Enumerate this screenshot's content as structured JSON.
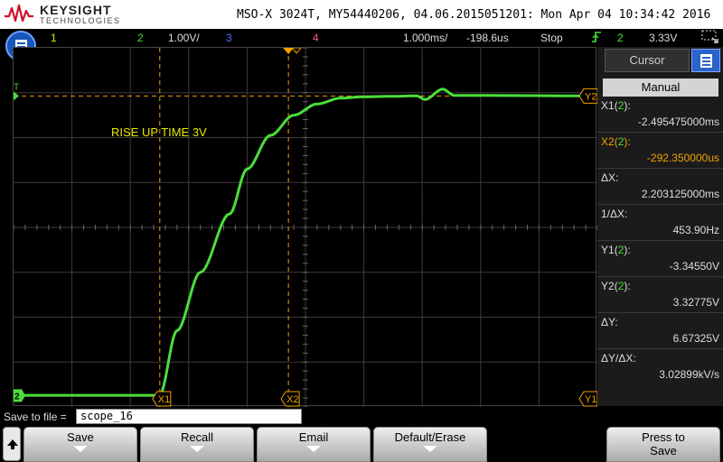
{
  "header": {
    "brand": "KEYSIGHT",
    "brand_sub": "TECHNOLOGIES",
    "scope_info": "MSO-X 3024T, MY54440206, 04.06.2015051201: Mon Apr 04 10:34:42 2016"
  },
  "statusbar": {
    "ch1": "1",
    "ch2": "2",
    "ch2_scale": "1.00V/",
    "ch3": "3",
    "ch4": "4",
    "timebase": "1.000ms/",
    "delay": "-198.6us",
    "run_state": "Stop",
    "trigger_channel": "2",
    "trigger_level": "3.33V"
  },
  "colors": {
    "ch1": "#e8e800",
    "ch2": "#4ade3a",
    "ch3": "#4a6fff",
    "ch4": "#ff4fa0",
    "cursor": "#f4a000",
    "grid": "#3c3c3c"
  },
  "waveform": {
    "annotation": "RISE UP TIME  3V",
    "channel_marker": "2",
    "cursor_labels": {
      "x1": "X1",
      "x2": "X2",
      "y1": "Y1",
      "y2": "Y2"
    },
    "trigger_marker": "T",
    "samples_ms": [
      [
        -5.0,
        -3.34
      ],
      [
        -2.5,
        -3.34
      ],
      [
        -2.2,
        -1.9
      ],
      [
        -1.8,
        -0.6
      ],
      [
        -1.3,
        0.7
      ],
      [
        -1.0,
        1.7
      ],
      [
        -0.6,
        2.45
      ],
      [
        -0.2,
        2.9
      ],
      [
        0.2,
        3.15
      ],
      [
        0.6,
        3.28
      ],
      [
        1.0,
        3.31
      ],
      [
        1.5,
        3.32
      ],
      [
        1.9,
        3.33
      ],
      [
        2.05,
        3.25
      ],
      [
        2.35,
        3.48
      ],
      [
        2.55,
        3.34
      ],
      [
        5.0,
        3.33
      ]
    ],
    "x1_ms": -2.495475,
    "x2_ms": -0.29235,
    "y1_v": -3.3455,
    "y2_v": 3.32775
  },
  "panel": {
    "title": "Cursor",
    "mode": "Manual",
    "x1_label": "X1",
    "x2_label": "X2",
    "x1_value": "-2.495475000ms",
    "x2_value": "-292.350000us",
    "dx_label": "ΔX:",
    "dx_value": "2.203125000ms",
    "inv_dx_label": "1/ΔX:",
    "inv_dx_value": "453.90Hz",
    "y1_label": "Y1",
    "y1_value": "-3.34550V",
    "y2_label": "Y2",
    "y2_value": "3.32775V",
    "dy_label": "ΔY:",
    "dy_value": "6.67325V",
    "dydx_label": "ΔY/ΔX:",
    "dydx_value": "3.02899kV/s"
  },
  "save_bar": {
    "label": "Save to file =",
    "filename": "scope_16"
  },
  "softkeys": {
    "save": "Save",
    "recall": "Recall",
    "email": "Email",
    "default_erase": "Default/Erase",
    "press_line1": "Press to",
    "press_line2": "Save"
  }
}
